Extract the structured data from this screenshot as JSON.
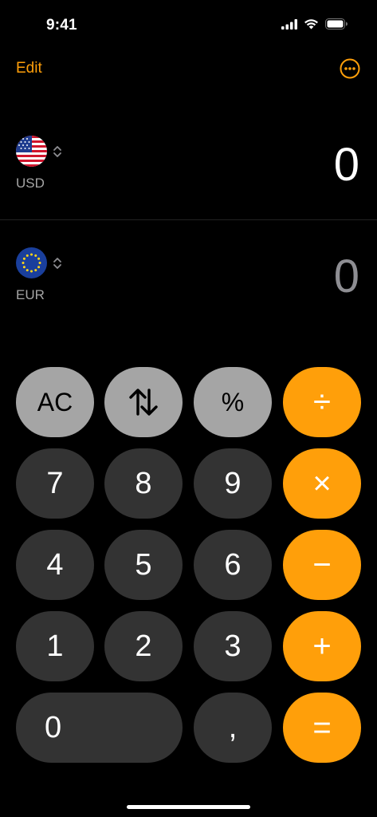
{
  "status_bar": {
    "time": "9:41"
  },
  "top_bar": {
    "edit_label": "Edit",
    "more_icon": "ellipsis-circle-icon"
  },
  "colors": {
    "accent": "#ff9f0a",
    "key_dark": "#333333",
    "key_light": "#a5a5a5",
    "secondary_text": "#8e8e93"
  },
  "currencies": [
    {
      "code": "USD",
      "flag": "us-flag-icon",
      "amount": "0"
    },
    {
      "code": "EUR",
      "flag": "eu-flag-icon",
      "amount": "0"
    }
  ],
  "keypad": {
    "clear": "AC",
    "swap_icon": "swap-arrows-icon",
    "percent": "%",
    "divide": "÷",
    "seven": "7",
    "eight": "8",
    "nine": "9",
    "multiply": "×",
    "four": "4",
    "five": "5",
    "six": "6",
    "minus": "−",
    "one": "1",
    "two": "2",
    "three": "3",
    "plus": "+",
    "zero": "0",
    "decimal": ",",
    "equals": "="
  }
}
